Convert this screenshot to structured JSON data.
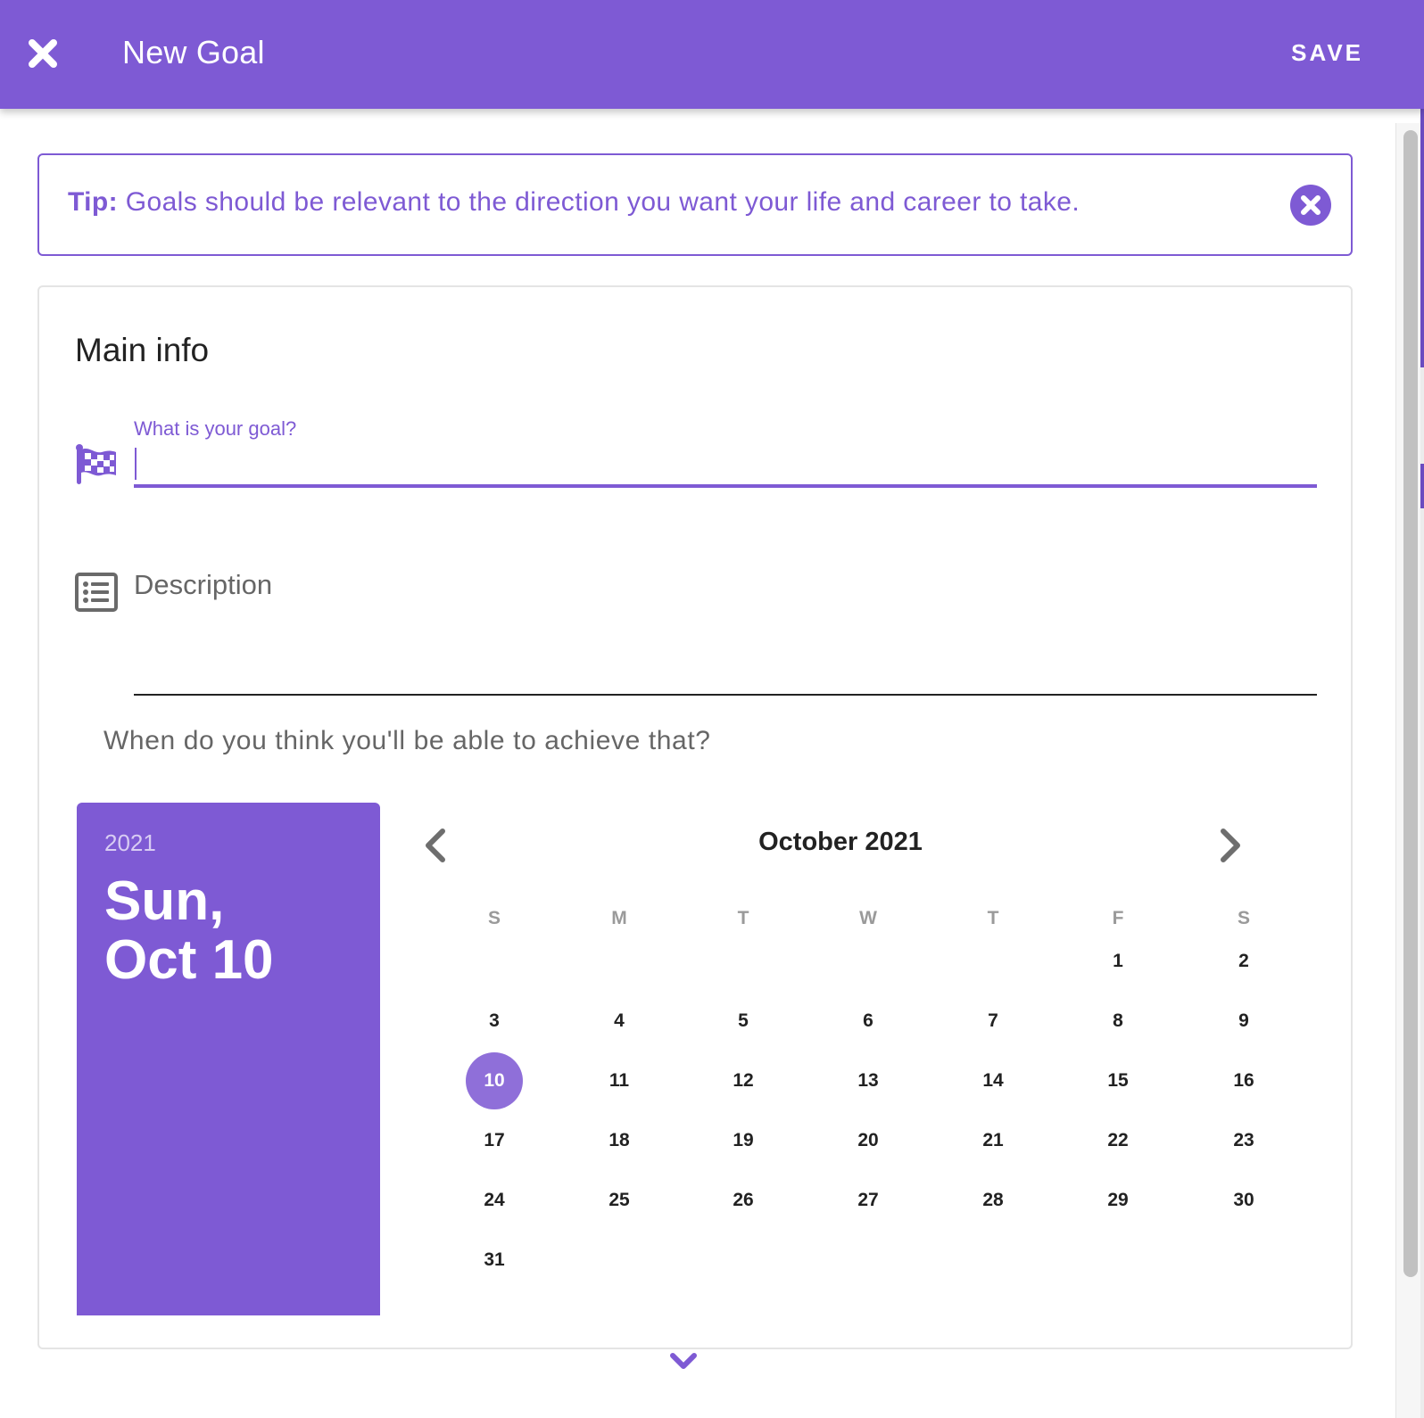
{
  "header": {
    "title": "New Goal",
    "save_label": "SAVE",
    "close_icon": "close-icon"
  },
  "colors": {
    "accent": "#7e5ad4",
    "selected_day": "#8f6fd9",
    "text_dark": "#222222",
    "text_muted": "#666666"
  },
  "tip": {
    "prefix": "Tip:",
    "text": " Goals should be relevant to the direction you want your life and career to take.",
    "dismiss_icon": "close-circle-icon"
  },
  "main_info": {
    "title": "Main info",
    "goal_field": {
      "label": "What is your goal?",
      "value": "",
      "icon": "checkered-flag-icon"
    },
    "description_field": {
      "placeholder": "Description",
      "value": "",
      "icon": "list-icon"
    },
    "when_question": "When do you think you'll be able to achieve that?"
  },
  "date_picker": {
    "selected_year": "2021",
    "selected_line1": "Sun,",
    "selected_line2": "Oct 10",
    "month_label": "October 2021",
    "weekdays": [
      "S",
      "M",
      "T",
      "W",
      "T",
      "F",
      "S"
    ],
    "first_weekday_index": 5,
    "days_in_month": 31,
    "selected_day": 10,
    "prev_icon": "chevron-left-icon",
    "next_icon": "chevron-right-icon"
  },
  "footer": {
    "expand_icon": "chevron-down-icon"
  }
}
